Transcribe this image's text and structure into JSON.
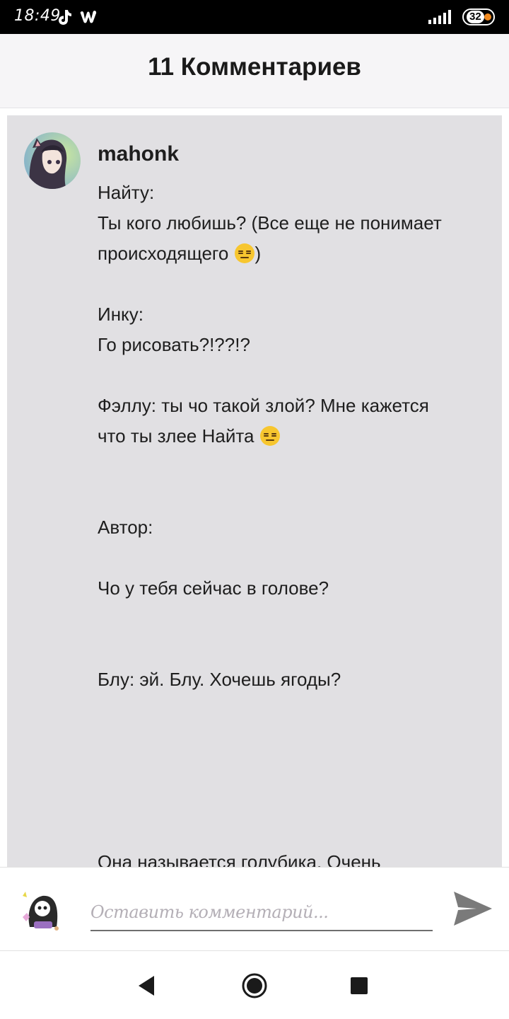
{
  "status_bar": {
    "time": "18:49",
    "battery": "32",
    "icons": [
      "tiktok-icon",
      "wattpad-icon",
      "signal-icon",
      "battery-icon"
    ]
  },
  "header": {
    "title": "11 Комментариев"
  },
  "comment": {
    "author": "mahonk",
    "lines": [
      "Найту:",
      "Ты кого любишь? (Все еще не понимает",
      "происходящего ",
      "",
      "Инку:",
      "Го рисовать?!??!?",
      "",
      "Фэллу: ты чо такой злой? Мне кажется",
      "что ты злее Найта ",
      "",
      "",
      "Автор:",
      "",
      "Чо у тебя сейчас в голове?",
      "",
      "",
      "Блу: эй. Блу. Хочешь ягоды?",
      "",
      "",
      "",
      "",
      "",
      "Она называется голубика. Очень"
    ],
    "line3_tail": ")",
    "emoji": "expressionless-face-emoji"
  },
  "input_bar": {
    "placeholder": "Оставить комментарий..."
  },
  "colors": {
    "card_background": "#e1e0e3",
    "header_background": "#f6f5f7",
    "send_icon": "#7a7a7a"
  }
}
